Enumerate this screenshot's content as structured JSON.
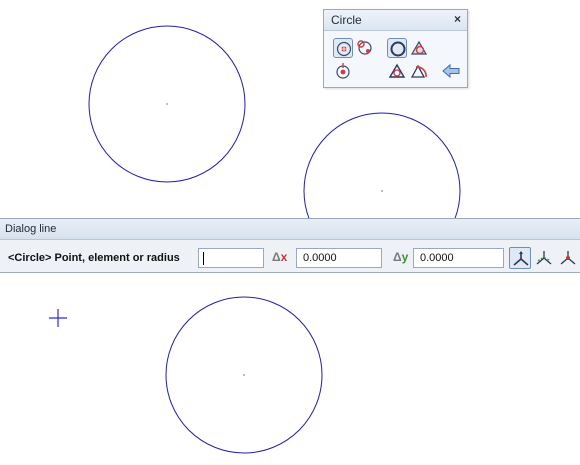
{
  "circle_toolbar": {
    "title": "Circle",
    "close_glyph": "×",
    "tools": [
      {
        "icon": "circle-center-point-icon",
        "active": true
      },
      {
        "icon": "circle-element-snap-icon",
        "active": false
      },
      {
        "icon": "circle-outline-icon",
        "active": true
      },
      {
        "icon": "triangle-circle-fill-icon",
        "active": false
      },
      {
        "icon": "circle-point-down-icon",
        "active": false
      },
      {
        "icon": "triangle-circle-icon",
        "active": false
      },
      {
        "icon": "triangle-arc-icon",
        "active": false
      },
      {
        "icon": "back-arrow-icon",
        "active": false
      }
    ]
  },
  "dialog_line": {
    "title": "Dialog line",
    "prompt": "<Circle> Point, element or radius",
    "main_value": "",
    "dx_symbol": "Δ",
    "dx_letter": "x",
    "dx_value": "0.0000",
    "dy_symbol": "Δ",
    "dy_letter": "y",
    "dy_value": "0.0000",
    "modes": [
      {
        "icon": "axis-mode-icon",
        "active": true
      },
      {
        "icon": "axis-delta-icon",
        "active": false
      },
      {
        "icon": "axis-polar-icon",
        "active": false
      }
    ]
  },
  "colors": {
    "circle_stroke": "#1f1fa8",
    "crosshair": "#2a2ad0",
    "panel_bg": "#f4f7fb",
    "delta_x": "#c0392b",
    "delta_y": "#3f8f3a"
  }
}
